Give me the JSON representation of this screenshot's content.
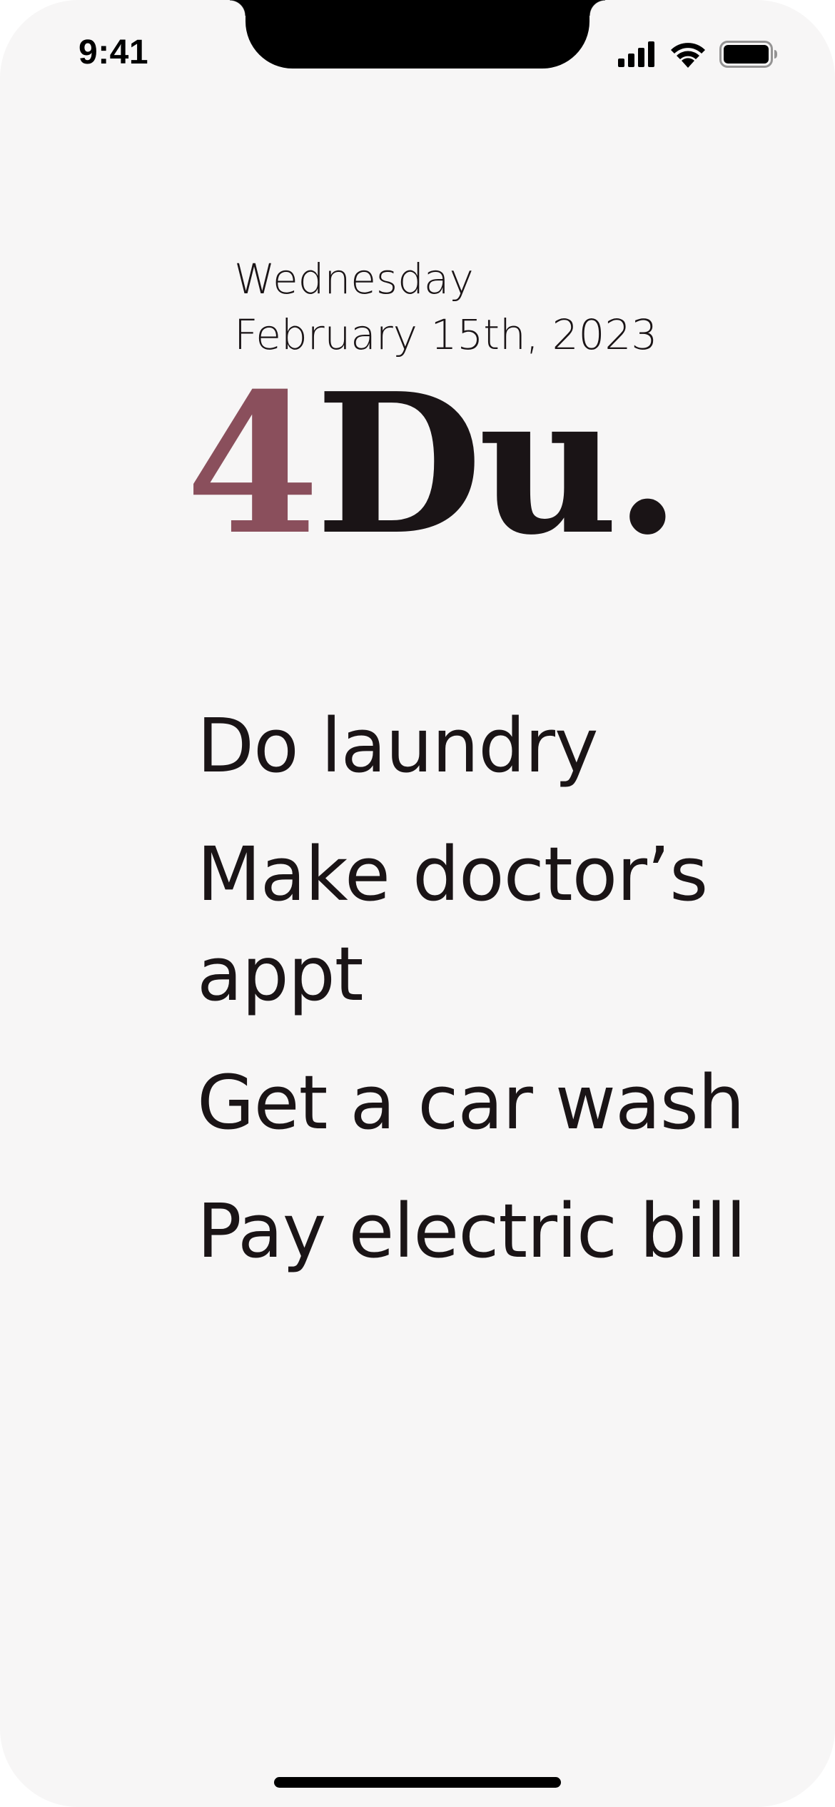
{
  "status_bar": {
    "time": "9:41",
    "icons": [
      "cellular-signal-icon",
      "wifi-icon",
      "battery-icon"
    ]
  },
  "header": {
    "weekday": "Wednesday",
    "date": "February 15th, 2023"
  },
  "logo": {
    "accent": "4",
    "main": "Du."
  },
  "tasks": [
    {
      "label": "Do laundry"
    },
    {
      "label": "Make doctor’s appt"
    },
    {
      "label": "Get a car wash"
    },
    {
      "label": "Pay electric bill"
    }
  ],
  "colors": {
    "background": "#f7f6f6",
    "text": "#1a1416",
    "accent": "#8a4f5c"
  }
}
